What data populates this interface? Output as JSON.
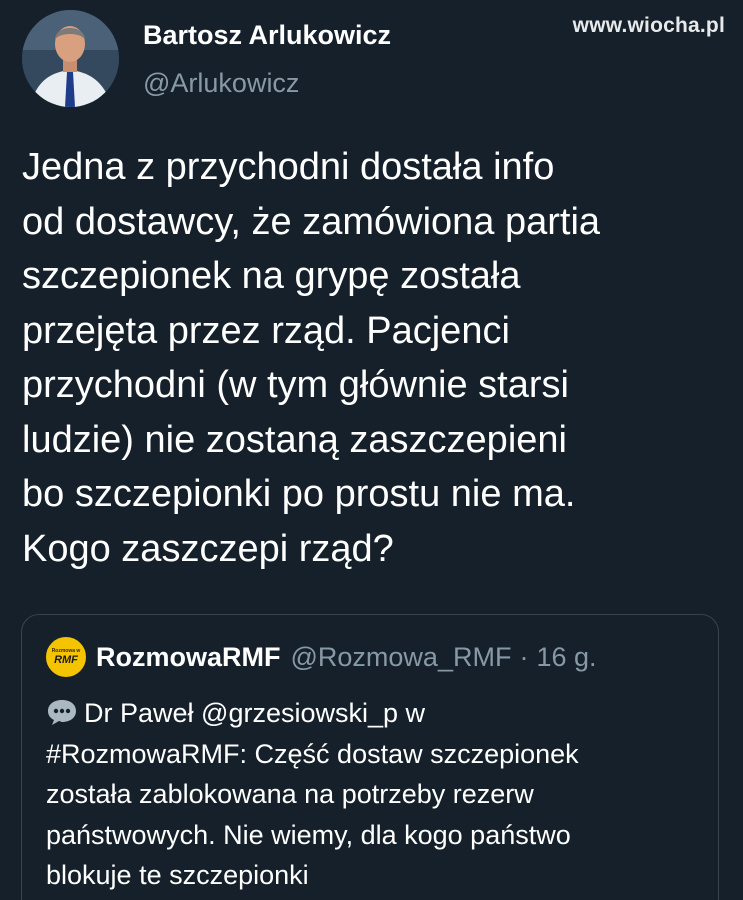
{
  "tweet": {
    "author_name": "Bartosz Arlukowicz",
    "author_handle": "@Arlukowicz",
    "text_lines": [
      "Jedna z przychodni dostała info",
      "od dostawcy, że zamówiona partia",
      "szczepionek na grypę została",
      "przejęta przez rząd. Pacjenci",
      "przychodni (w tym głównie starsi",
      "ludzie) nie zostaną zaszczepieni",
      "bo szczepionki po prostu nie ma.",
      "Kogo zaszczepi rząd?"
    ]
  },
  "watermark": "www.wiocha.pl",
  "quote": {
    "logo_text_small": "Rozmowa w",
    "logo_text_big": "RMF",
    "author_name": "RozmowaRMF",
    "author_handle": "@Rozmowa_RMF",
    "separator": "·",
    "time": "16 g.",
    "text_lines": [
      "Dr Paweł @grzesiowski_p w",
      "#RozmowaRMF: Część dostaw szczepionek",
      "została zablokowana na potrzeby rezerw",
      "państwowych. Nie wiemy, dla kogo państwo",
      "blokuje te szczepionki"
    ]
  },
  "colors": {
    "background": "#15202b",
    "text": "#ffffff",
    "secondary_text": "#8899a6",
    "card_border": "#38444d",
    "speech_bubble": "#aab8c2",
    "rmf_logo": "#f5c400"
  },
  "icons": {
    "avatar": "profile-photo",
    "quote_prefix": "speech-bubble-icon",
    "quote_avatar": "rmf-logo"
  }
}
